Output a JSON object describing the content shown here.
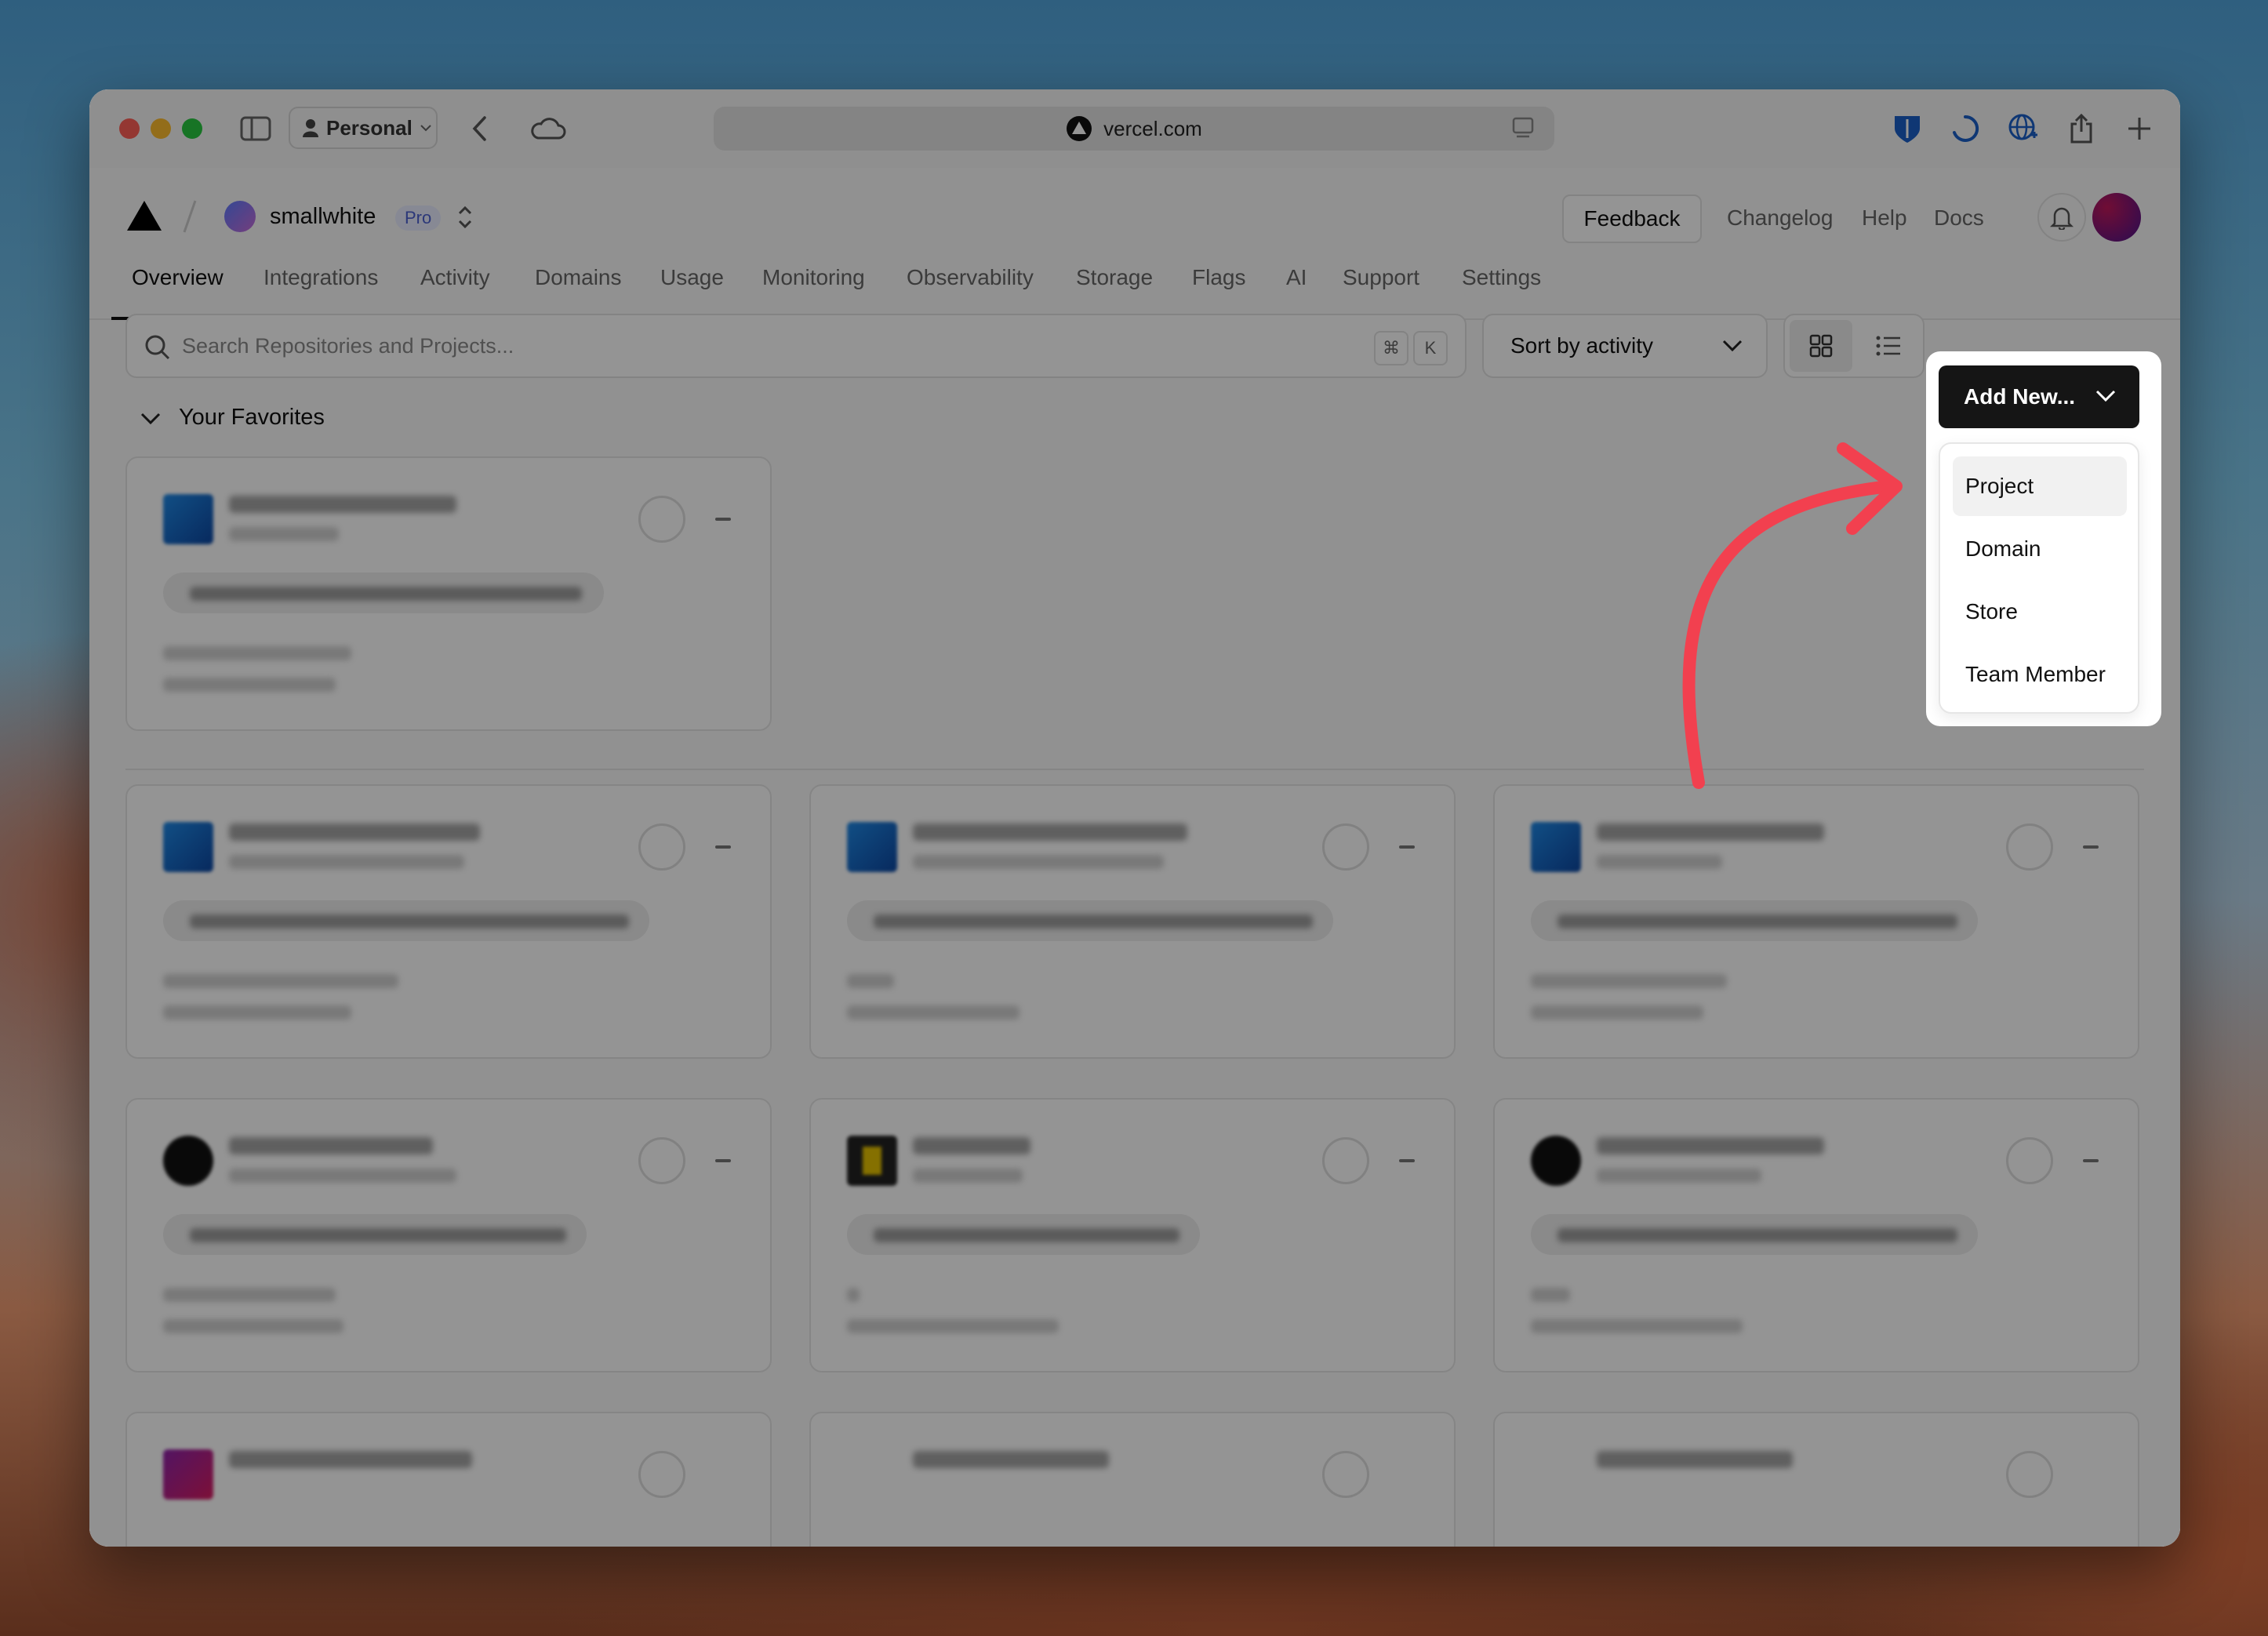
{
  "browser": {
    "profile_label": "Personal",
    "url": "vercel.com"
  },
  "header": {
    "team_name": "smallwhite",
    "plan_badge": "Pro",
    "feedback_label": "Feedback",
    "links": [
      "Changelog",
      "Help",
      "Docs"
    ]
  },
  "tabs": [
    "Overview",
    "Integrations",
    "Activity",
    "Domains",
    "Usage",
    "Monitoring",
    "Observability",
    "Storage",
    "Flags",
    "AI",
    "Support",
    "Settings"
  ],
  "toolbar": {
    "search_placeholder": "Search Repositories and Projects...",
    "shortcut_cmd": "⌘",
    "shortcut_key": "K",
    "sort_label": "Sort by activity",
    "add_new_label": "Add New..."
  },
  "favorites": {
    "title": "Your Favorites"
  },
  "add_new_menu": {
    "items": [
      "Project",
      "Domain",
      "Store",
      "Team Member"
    ],
    "highlighted_item": "Project"
  },
  "colors": {
    "accent_arrow": "#f2404f",
    "primary_button": "#151515"
  }
}
